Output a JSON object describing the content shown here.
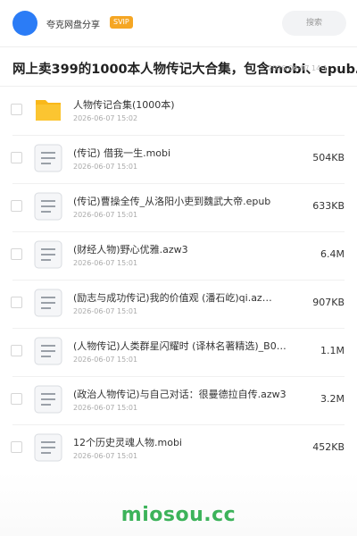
{
  "header": {
    "brand": "夸克网盘分享",
    "badge": "SVIP",
    "search_label": "搜索"
  },
  "page": {
    "title": "网上卖399的1000本人物传记大合集，包含mobi、epub…",
    "meta": "2026-06-07 14:1"
  },
  "files": [
    {
      "name": "人物传记合集(1000本)",
      "date": "2026-06-07 15:02",
      "size": "",
      "type": "folder"
    },
    {
      "name": "(传记) 借我一生.mobi",
      "date": "2026-06-07 15:01",
      "size": "504KB",
      "type": "document"
    },
    {
      "name": "(传记)曹操全传_从洛阳小吏到魏武大帝.epub",
      "date": "2026-06-07 15:01",
      "size": "633KB",
      "type": "document"
    },
    {
      "name": "(财经人物)野心优雅.azw3",
      "date": "2026-06-07 15:01",
      "size": "6.4M",
      "type": "document"
    },
    {
      "name": "(励志与成功传记)我的价值观 (潘石屹)qi.az…",
      "date": "2026-06-07 15:01",
      "size": "907KB",
      "type": "document"
    },
    {
      "name": "(人物传记)人类群星闪耀时 (译林名著精选)_B0…",
      "date": "2026-06-07 15:01",
      "size": "1.1M",
      "type": "document"
    },
    {
      "name": "(政治人物传记)与自己对话：很曼德拉自传.azw3",
      "date": "2026-06-07 15:01",
      "size": "3.2M",
      "type": "document"
    },
    {
      "name": "12个历史灵魂人物.mobi",
      "date": "2026-06-07 15:01",
      "size": "452KB",
      "type": "document"
    }
  ],
  "footer": {
    "watermark": "miosou.cc"
  },
  "colors": {
    "accent_blue": "#2b7cf6",
    "svip_orange": "#f5a623",
    "folder_yellow": "#fbc531",
    "watermark_green": "#3cb35a"
  }
}
